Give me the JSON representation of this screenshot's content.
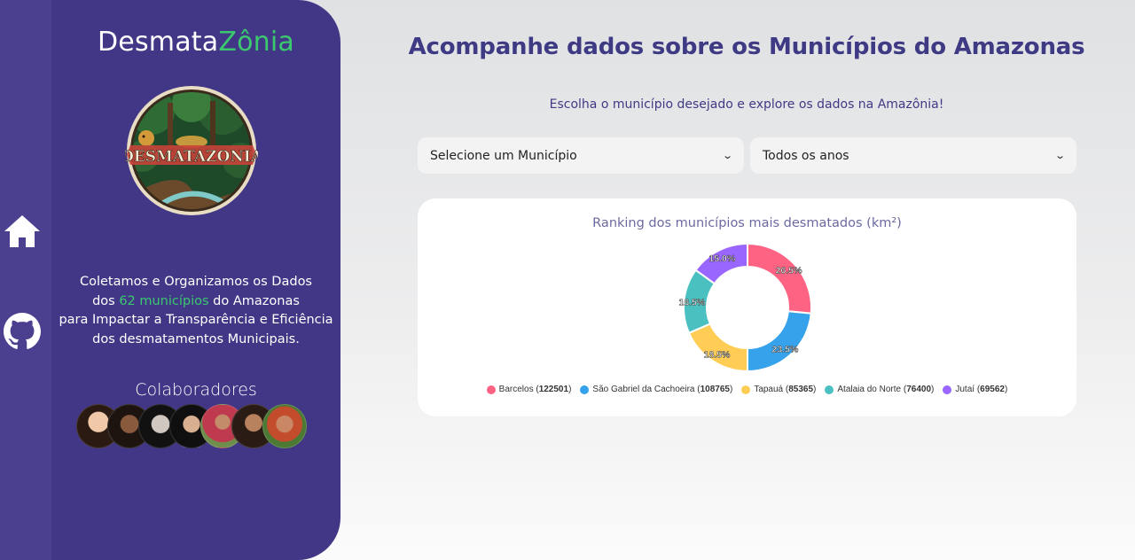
{
  "sidebar": {
    "brand_prefix": "Desmata",
    "brand_suffix": "Zônia",
    "logo_text": "DESMATAZONIA",
    "about_line1": "Coletamos e Organizamos os Dados",
    "about_line2_pre": "dos ",
    "about_line2_highlight": "62 municípios",
    "about_line2_post": " do Amazonas",
    "about_line3": "para Impactar a Transparência e Eficiência",
    "about_line4": "dos desmatamentos Municipais.",
    "collab_title": "Colaboradores",
    "avatar_count": 7
  },
  "rail": {
    "items": [
      "home-icon",
      "github-icon"
    ]
  },
  "main": {
    "title": "Acompanhe dados sobre os Municípios do Amazonas",
    "subtitle": "Escolha o município desejado e explore os dados na Amazônia!",
    "select_municipio": "Selecione um Município",
    "select_ano": "Todos os anos"
  },
  "chart_data": {
    "type": "pie",
    "title": "Ranking dos municípios mais desmatados (km²)",
    "categories": [
      "Barcelos",
      "São Gabriel da Cachoeira",
      "Tapauá",
      "Atalaia do Norte",
      "Jutaí"
    ],
    "values": [
      122501,
      108765,
      85365,
      76400,
      69562
    ],
    "percent_labels": [
      "26.5%",
      "23.5%",
      "18.5%",
      "16.5%",
      "15.0%"
    ],
    "colors": [
      "#ff6384",
      "#36a2eb",
      "#ffcd56",
      "#4bc0c0",
      "#9966ff"
    ],
    "legend_position": "bottom"
  },
  "colors": {
    "rail": "#4b3f8f",
    "sidebar": "#413786",
    "accent_green": "#3cc86e",
    "heading": "#3f3a84"
  }
}
